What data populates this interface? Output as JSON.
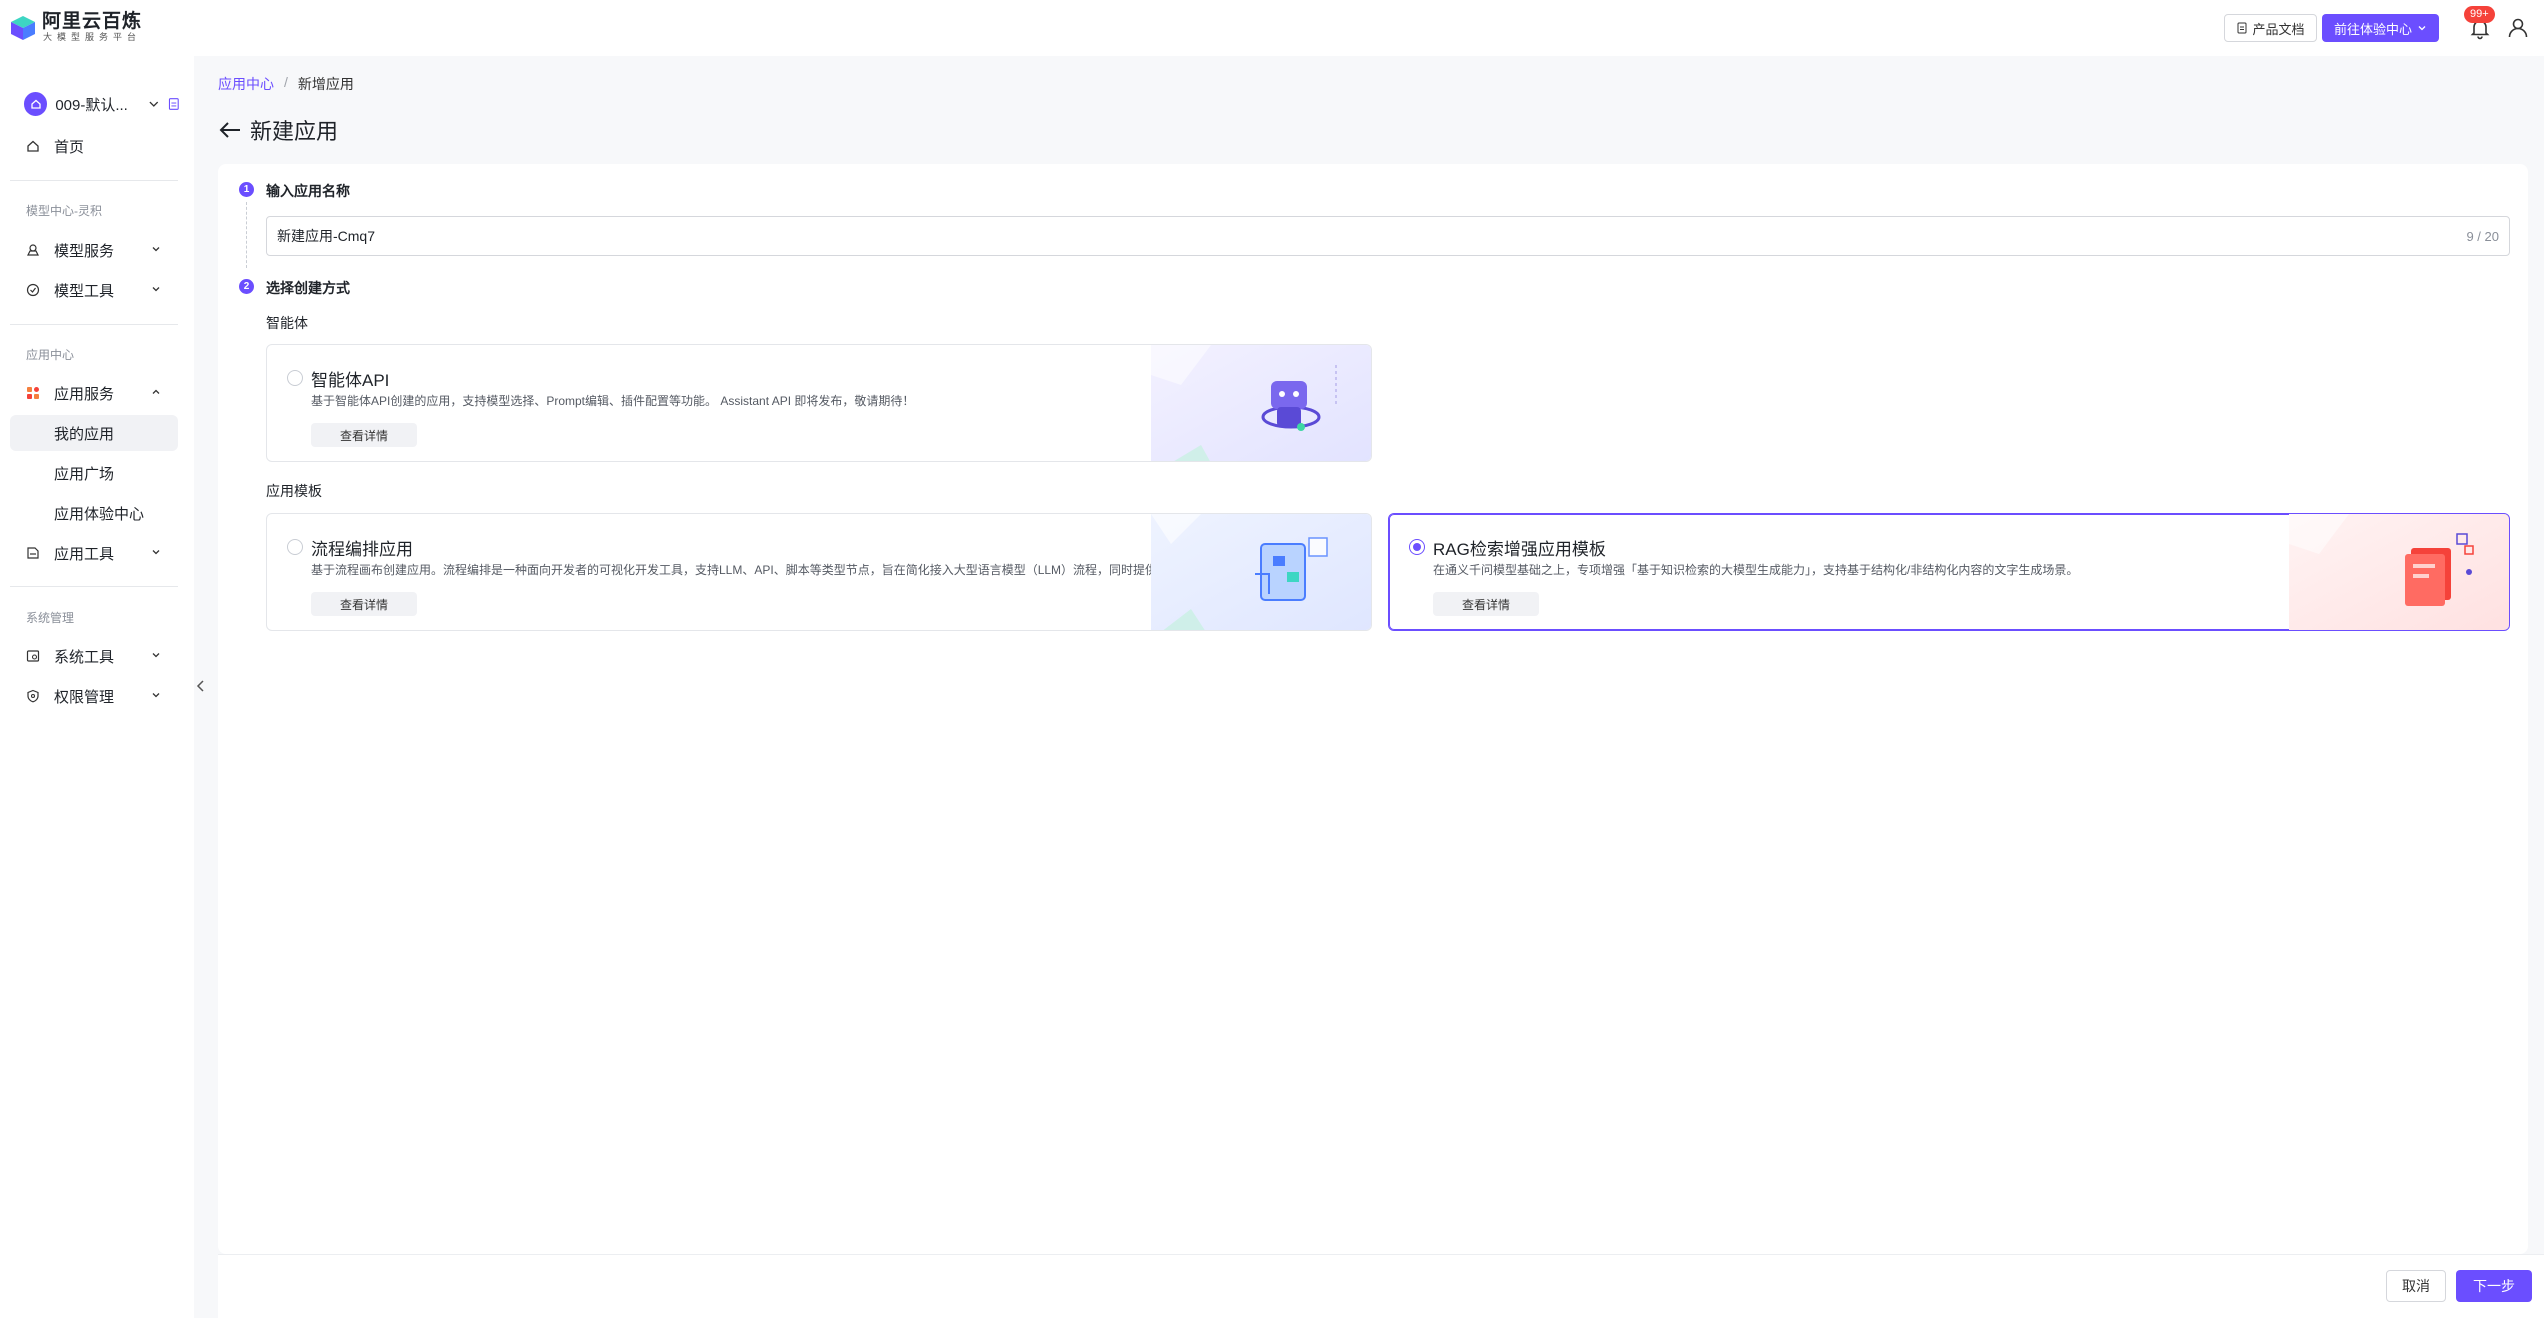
{
  "header": {
    "brand_title": "阿里云百炼",
    "brand_subtitle": "大模型服务平台",
    "doc_button": "产品文档",
    "experience_button": "前往体验中心",
    "notification_badge": "99+",
    "accent_color": "#6b4eff"
  },
  "sidebar": {
    "workspace_name": "009-默认...",
    "home": "首页",
    "group_model": "模型中心-灵积",
    "model_service": "模型服务",
    "model_tools": "模型工具",
    "group_app": "应用中心",
    "app_service": "应用服务",
    "my_apps": "我的应用",
    "app_square": "应用广场",
    "app_experience": "应用体验中心",
    "app_tools": "应用工具",
    "group_system": "系统管理",
    "system_tools": "系统工具",
    "permission": "权限管理"
  },
  "breadcrumb": {
    "parent": "应用中心",
    "separator": "/",
    "current": "新增应用"
  },
  "page": {
    "title": "新建应用"
  },
  "form": {
    "step1_number": "1",
    "step1_label": "输入应用名称",
    "app_name_value": "新建应用-Cmq7",
    "app_name_count": "9 / 20",
    "step2_number": "2",
    "step2_label": "选择创建方式",
    "section_agent": "智能体",
    "section_template": "应用模板"
  },
  "options": {
    "agent_api": {
      "title": "智能体API",
      "desc": "基于智能体API创建的应用，支持模型选择、Prompt编辑、插件配置等功能。 Assistant API 即将发布，敬请期待！",
      "detail": "查看详情",
      "selected": false
    },
    "flow": {
      "title": "流程编排应用",
      "desc": "基于流程画布创建应用。流程编排是一种面向开发者的可视化开发工具，支持LLM、API、脚本等类型节点，旨在简化接入大型语言模型（LLM）流程，同时提供应用流程的全...",
      "detail": "查看详情",
      "selected": false
    },
    "rag": {
      "title": "RAG检索增强应用模板",
      "desc": "在通义千问模型基础之上，专项增强「基于知识检索的大模型生成能力」，支持基于结构化/非结构化内容的文字生成场景。",
      "detail": "查看详情",
      "selected": true
    }
  },
  "footer": {
    "cancel": "取消",
    "next": "下一步"
  }
}
